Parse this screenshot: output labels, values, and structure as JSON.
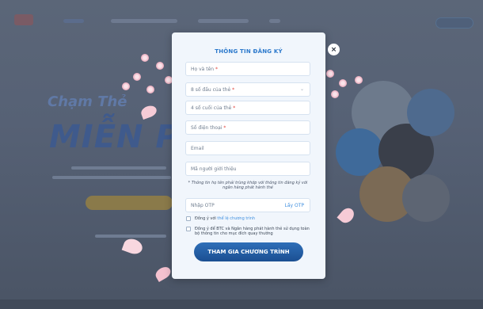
{
  "modal": {
    "title": "THÔNG TIN ĐĂNG KÝ",
    "fields": [
      {
        "label": "Họ và tên",
        "required": "*"
      },
      {
        "label": "8 số đầu của thẻ",
        "required": "*"
      },
      {
        "label": "4 số cuối của thẻ",
        "required": "*"
      },
      {
        "label": "Số điện thoại",
        "required": "*"
      },
      {
        "label": "Email",
        "required": ""
      },
      {
        "label": "Mã người giới thiệu",
        "required": ""
      }
    ],
    "note": "* Thông tin họ tên phải trùng khớp với thông tin đăng ký với ngân hàng phát hành thẻ",
    "otp": {
      "placeholder": "Nhập OTP",
      "link": "Lấy OTP"
    },
    "agree_rules_prefix": "Đồng ý với",
    "agree_rules_link": "thể lệ chương trình",
    "agree_share": "Đồng ý để BTC và Ngân hàng phát hành thẻ sử dụng toàn bộ thông tin cho mục đích quay thưởng",
    "submit_label": "THAM GIA CHƯƠNG TRÌNH",
    "close_icon": "×"
  },
  "background": {
    "headline_small": "Chạm Thẻ",
    "headline_big": "MIỄN P"
  },
  "colors": {
    "title_blue": "#2c79cc",
    "button_blue": "#1b4f92",
    "link_blue": "#3f8fdf",
    "required_red": "#e2453c",
    "modal_bg": "#f1f6fc"
  }
}
